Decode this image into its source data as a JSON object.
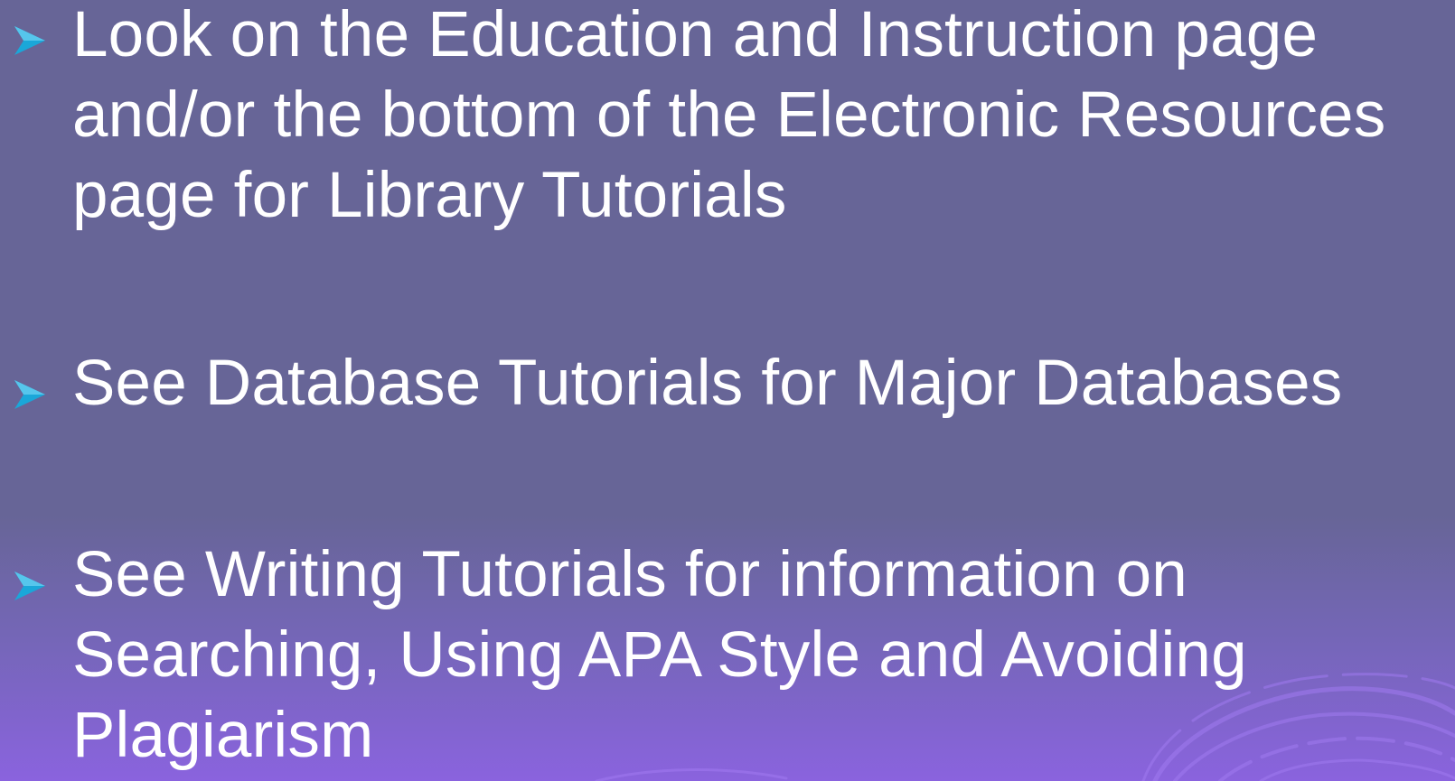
{
  "slide": {
    "bullets": [
      {
        "text": "Look on the Education and Instruction page\nand/or the bottom of the Electronic Resources\npage for Library Tutorials"
      },
      {
        "text": "See Database Tutorials for Major Databases"
      },
      {
        "text": "See Writing Tutorials for information on\nSearching, Using APA Style and Avoiding\nPlagiarism"
      }
    ],
    "colors": {
      "background": "#676597",
      "background_bottom": "#8a63de",
      "text": "#ffffff",
      "bullet_arrow": "#1aa7d9"
    },
    "icons": {
      "bullet": "arrowhead-bullet-icon",
      "decoration": "swirl-decoration"
    }
  }
}
